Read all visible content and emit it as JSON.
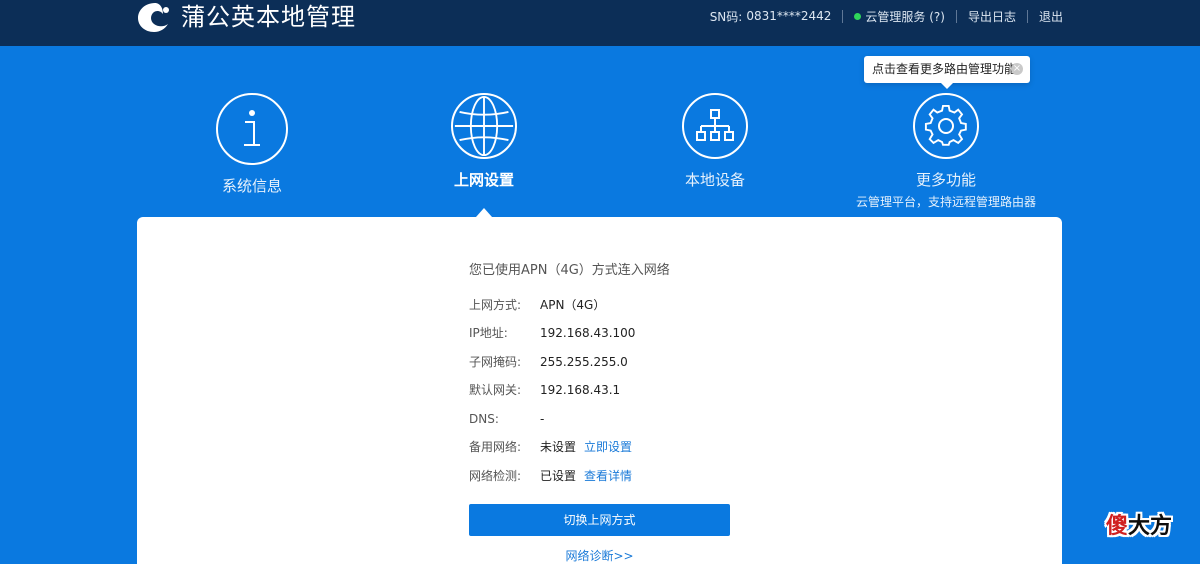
{
  "header": {
    "brand": "蒲公英本地管理",
    "sn_label": "SN码:",
    "sn_value": "0831****2442",
    "cloud_service": "云管理服务 (?)",
    "export_log": "导出日志",
    "logout": "退出"
  },
  "nav": {
    "items": [
      {
        "label": "系统信息",
        "icon": "info-icon"
      },
      {
        "label": "上网设置",
        "icon": "globe-icon",
        "active": true
      },
      {
        "label": "本地设备",
        "icon": "network-tree-icon"
      },
      {
        "label": "更多功能",
        "icon": "gear-icon",
        "sub": "云管理平台，支持远程管理路由器"
      }
    ]
  },
  "tooltip": {
    "text": "点击查看更多路由管理功能"
  },
  "main": {
    "status_text": "您已使用APN（4G）方式连入网络",
    "rows": [
      {
        "key": "上网方式:",
        "value": "APN（4G）"
      },
      {
        "key": "IP地址:",
        "value": "192.168.43.100"
      },
      {
        "key": "子网掩码:",
        "value": "255.255.255.0"
      },
      {
        "key": "默认网关:",
        "value": "192.168.43.1"
      },
      {
        "key": "DNS:",
        "value": "-"
      },
      {
        "key": "备用网络:",
        "value": "未设置",
        "action": "立即设置"
      },
      {
        "key": "网络检测:",
        "value": "已设置",
        "action": "查看详情"
      }
    ],
    "switch_button": "切换上网方式",
    "diag_link": "网络诊断>>"
  },
  "watermark": {
    "part1": "傻",
    "part2": "大方"
  },
  "colors": {
    "topbar": "#0c2e57",
    "background": "#0a79e0",
    "accent": "#0a79e0",
    "link": "#1a7ad8",
    "status_ok": "#2fd65a"
  }
}
